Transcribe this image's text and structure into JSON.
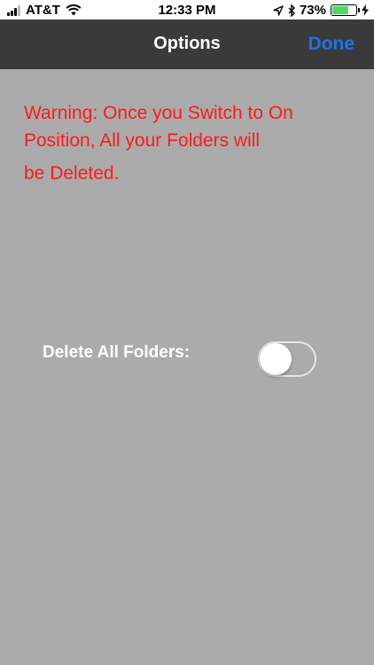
{
  "status_bar": {
    "carrier": "AT&T",
    "time": "12:33 PM",
    "battery_percent": "73%",
    "battery_level": 0.73,
    "icons": [
      "signal-icon",
      "wifi-icon",
      "location-arrow-icon",
      "bluetooth-icon",
      "battery-icon",
      "charging-bolt-icon"
    ]
  },
  "nav": {
    "title": "Options",
    "done_label": "Done"
  },
  "warning": {
    "lines": [
      "Warning: Once you Switch to On",
      "Position, All your Folders will",
      "be Deleted."
    ]
  },
  "settings": {
    "delete_label": "Delete All Folders:",
    "delete_enabled": false
  },
  "colors": {
    "background": "#ababab",
    "nav_bar": "#3a3a3a",
    "accent": "#1a73e8",
    "warning": "#ff1a1a",
    "battery": "#4cd964"
  }
}
